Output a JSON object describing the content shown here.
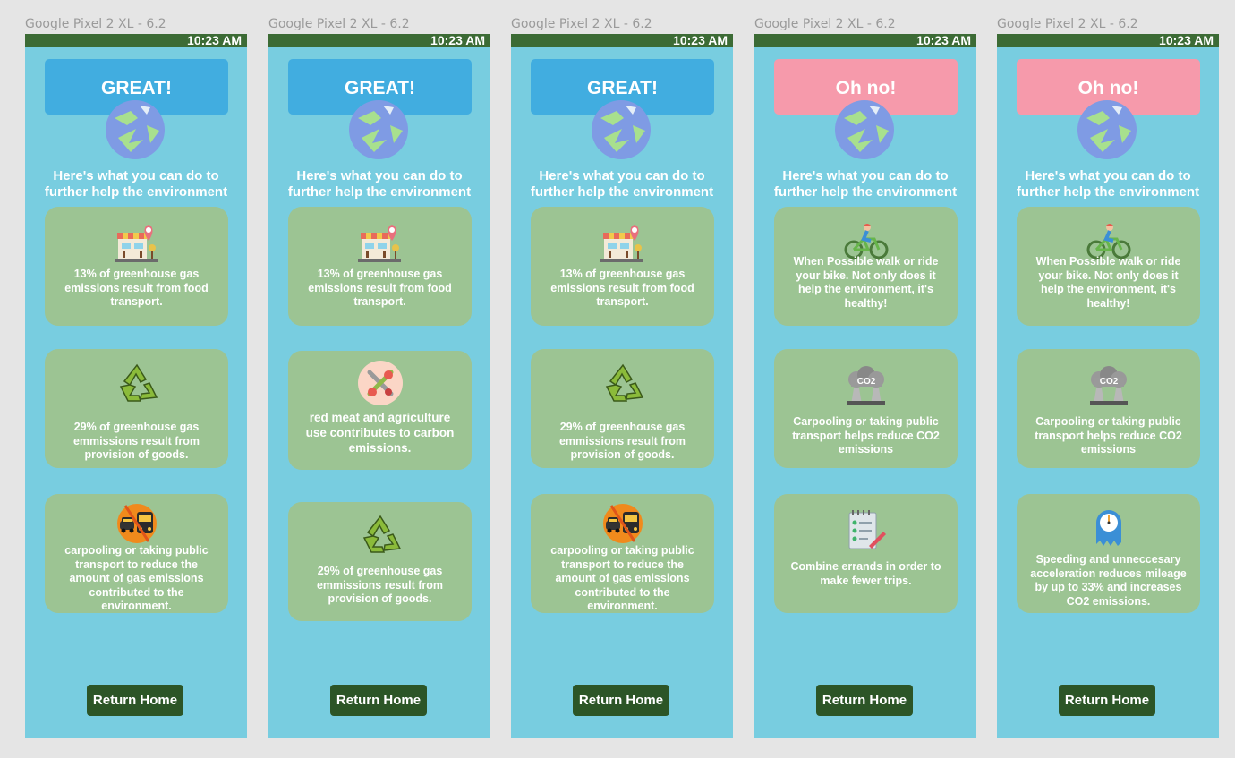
{
  "frames": [
    {
      "label": "Google Pixel 2 XL - 6.2",
      "time": "10:23 AM",
      "banner": "GREAT!",
      "banner_type": "great",
      "help_text": "Here's what you can do to further help the environment",
      "cards": [
        {
          "icon": "store-location-icon",
          "text": "13% of greenhouse gas emissions result from food transport."
        },
        {
          "icon": "recycle-icon",
          "text": "29% of greenhouse gas emmissions result from provision of goods."
        },
        {
          "icon": "car-bus-icon",
          "text": "carpooling or taking public transport to reduce the amount of gas emissions contributed to the environment."
        }
      ],
      "button": "Return Home"
    },
    {
      "label": "Google Pixel 2 XL - 6.2",
      "time": "10:23 AM",
      "banner": "GREAT!",
      "banner_type": "great",
      "help_text": "Here's what you can do to further help the environment",
      "cards": [
        {
          "icon": "store-location-icon",
          "text": "13% of greenhouse gas emissions result from food transport."
        },
        {
          "icon": "no-meat-icon",
          "text": "red meat and agriculture use contributes to carbon emissions."
        },
        {
          "icon": "recycle-icon",
          "text": "29% of greenhouse gas emmissions result from provision of goods."
        }
      ],
      "button": "Return Home"
    },
    {
      "label": "Google Pixel 2 XL - 6.2",
      "time": "10:23 AM",
      "banner": "GREAT!",
      "banner_type": "great",
      "help_text": "Here's what you can do to further help the environment",
      "cards": [
        {
          "icon": "store-location-icon",
          "text": "13% of greenhouse gas emissions result from food transport."
        },
        {
          "icon": "recycle-icon",
          "text": "29% of greenhouse gas emmissions result from provision of goods."
        },
        {
          "icon": "car-bus-icon",
          "text": "carpooling or taking public transport to reduce the amount of gas emissions contributed to the environment."
        }
      ],
      "button": "Return Home"
    },
    {
      "label": "Google Pixel 2 XL - 6.2",
      "time": "10:23 AM",
      "banner": "Oh no!",
      "banner_type": "oh",
      "help_text": "Here's what you can do to further help the environment",
      "cards": [
        {
          "icon": "cyclist-icon",
          "text": "When Possible walk or ride your bike. Not only does it help the environment, it's healthy!"
        },
        {
          "icon": "co2-factory-icon",
          "text": "Carpooling or taking public transport helps reduce CO2 emissions"
        },
        {
          "icon": "checklist-icon",
          "text": "Combine errands in order to make fewer trips."
        }
      ],
      "button": "Return Home"
    },
    {
      "label": "Google Pixel 2 XL - 6.2",
      "time": "10:23 AM",
      "banner": "Oh no!",
      "banner_type": "oh",
      "help_text": "Here's what you can do to further help the environment",
      "cards": [
        {
          "icon": "cyclist-icon",
          "text": "When Possible walk or ride your bike. Not only does it help the environment, it's healthy!"
        },
        {
          "icon": "co2-factory-icon",
          "text": "Carpooling or taking public transport helps reduce CO2 emissions"
        },
        {
          "icon": "speed-gauge-icon",
          "text": "Speeding and unneccesary acceleration reduces mileage by up to 33% and increases CO2 emissions."
        }
      ],
      "button": "Return Home"
    }
  ],
  "colors": {
    "page_bg": "#e5e5e5",
    "phone_bg": "#78cde0",
    "status_bar": "#3c6b35",
    "great_banner": "#41ade0",
    "oh_no_banner": "#f69aab",
    "card": "#9cc493",
    "button": "#2c5527"
  }
}
